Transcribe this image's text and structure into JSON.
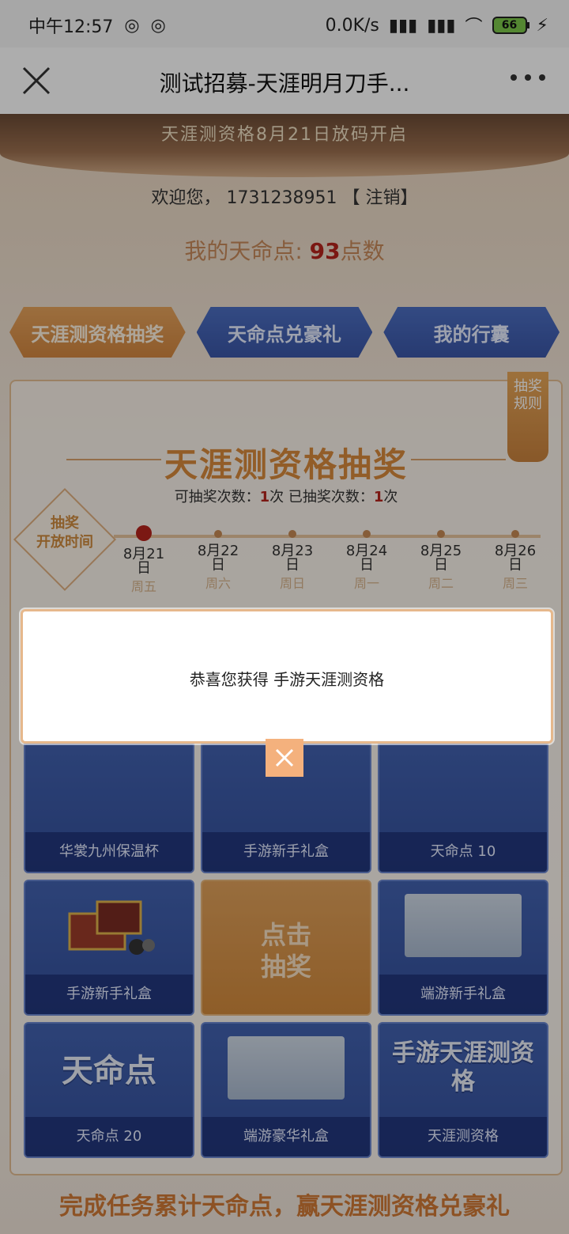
{
  "status": {
    "time": "中午12:57",
    "net_speed": "0.0K/s",
    "battery": "66"
  },
  "title_bar": {
    "title": "测试招募-天涯明月刀手..."
  },
  "hero": {
    "banner": "天涯测资格8月21日放码开启"
  },
  "welcome": {
    "prefix": "欢迎您，",
    "user": "1731238951",
    "logout": "【 注销】"
  },
  "points": {
    "label": "我的天命点:",
    "value": "93",
    "unit": "点数"
  },
  "tabs": [
    {
      "label": "天涯测资格抽奖"
    },
    {
      "label": "天命点兑豪礼"
    },
    {
      "label": "我的行囊"
    }
  ],
  "panel": {
    "rules": "抽奖规则",
    "title": "天涯测资格抽奖",
    "available_label": "可抽奖次数：",
    "available_value": "1",
    "times_unit": "次",
    "used_label": "已抽奖次数：",
    "used_value": "1",
    "time_badge": [
      "抽奖",
      "开放时间"
    ],
    "days": [
      {
        "date": "8月21日",
        "weekday": "周五"
      },
      {
        "date": "8月22日",
        "weekday": "周六"
      },
      {
        "date": "8月23日",
        "weekday": "周日"
      },
      {
        "date": "8月24日",
        "weekday": "周一"
      },
      {
        "date": "8月25日",
        "weekday": "周二"
      },
      {
        "date": "8月26日",
        "weekday": "周三"
      }
    ]
  },
  "grid": {
    "row1": [
      "华裳九州保温杯",
      "手游新手礼盒",
      "天命点 10"
    ],
    "row2": [
      "手游新手礼盒",
      "点击抽奖",
      "端游新手礼盒"
    ],
    "row3": [
      "天命点 20",
      "端游豪华礼盒",
      "天涯测资格"
    ],
    "draw_line1": "点击",
    "draw_line2": "抽奖",
    "big_tianming": "天命点",
    "big_tianya": "手游天涯测资格"
  },
  "footer": {
    "text": "完成任务累计天命点，赢天涯测资格兑豪礼"
  },
  "modal": {
    "message": "恭喜您获得 手游天涯测资格"
  }
}
